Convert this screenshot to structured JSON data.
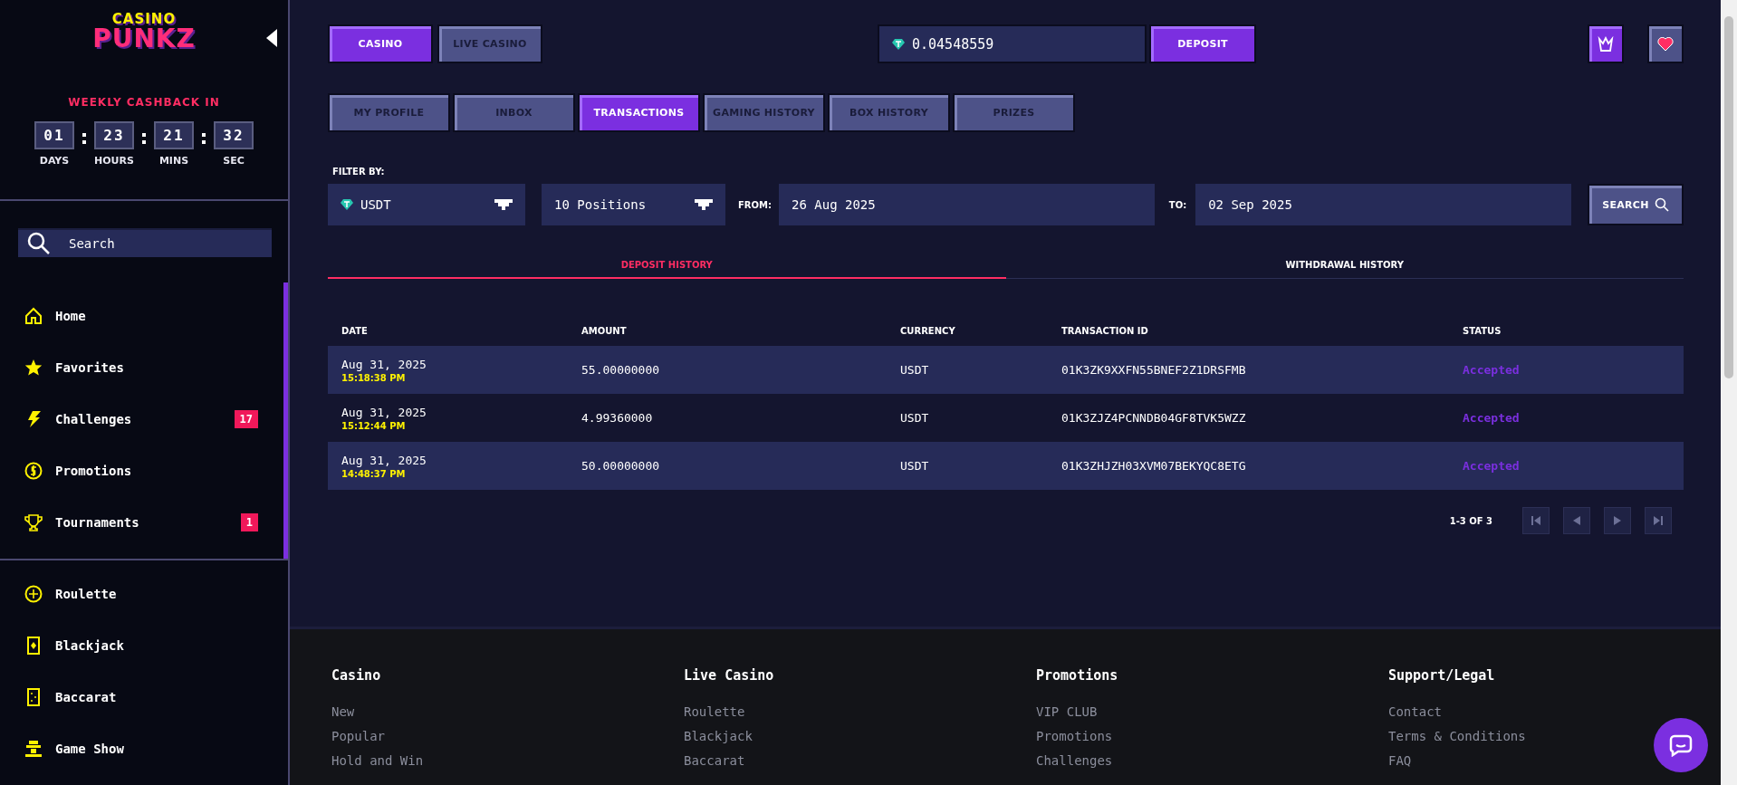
{
  "sidebar": {
    "logo": {
      "top": "CASINO",
      "bottom": "PUNKZ"
    },
    "cashback": {
      "title": "WEEKLY CASHBACK IN",
      "units": [
        {
          "value": "01",
          "label": "DAYS"
        },
        {
          "value": "23",
          "label": "HOURS"
        },
        {
          "value": "21",
          "label": "MINS"
        },
        {
          "value": "32",
          "label": "SEC"
        }
      ]
    },
    "search": {
      "placeholder": "Search"
    },
    "nav": [
      {
        "kind": "home",
        "label": "Home"
      },
      {
        "kind": "star",
        "label": "Favorites"
      },
      {
        "kind": "bolt",
        "label": "Challenges",
        "badge": "17"
      },
      {
        "kind": "coin",
        "label": "Promotions"
      },
      {
        "kind": "trophy",
        "label": "Tournaments",
        "badge": "1"
      }
    ],
    "games": [
      {
        "kind": "roulette",
        "label": "Roulette"
      },
      {
        "kind": "card",
        "label": "Blackjack"
      },
      {
        "kind": "domino",
        "label": "Baccarat"
      },
      {
        "kind": "host",
        "label": "Game Show"
      }
    ]
  },
  "topbar": {
    "modes": [
      {
        "label": "CASINO",
        "selected": true
      },
      {
        "label": "LIVE CASINO",
        "selected": false
      }
    ],
    "balance": "0.04548559",
    "deposit": "DEPOSIT"
  },
  "profile_tabs": [
    {
      "label": "MY PROFILE",
      "selected": false
    },
    {
      "label": "INBOX",
      "selected": false
    },
    {
      "label": "TRANSACTIONS",
      "selected": true
    },
    {
      "label": "GAMING HISTORY",
      "selected": false
    },
    {
      "label": "BOX HISTORY",
      "selected": false
    },
    {
      "label": "PRIZES",
      "selected": false
    }
  ],
  "filter": {
    "title": "FILTER BY:",
    "currency": "USDT",
    "positions": "10 Positions",
    "from_label": "FROM:",
    "from": "26 Aug 2025",
    "to_label": "TO:",
    "to": "02 Sep 2025",
    "search": "SEARCH"
  },
  "history_tabs": [
    {
      "label": "DEPOSIT HISTORY",
      "selected": true
    },
    {
      "label": "WITHDRAWAL HISTORY",
      "selected": false
    }
  ],
  "table": {
    "columns": [
      "DATE",
      "AMOUNT",
      "CURRENCY",
      "TRANSACTION ID",
      "STATUS"
    ],
    "rows": [
      {
        "date": "Aug 31, 2025",
        "time": "15:18:38 PM",
        "amount": "55.00000000",
        "currency": "USDT",
        "id": "01K3ZK9XXFN55BNEF2Z1DRSFMB",
        "status": "Accepted"
      },
      {
        "date": "Aug 31, 2025",
        "time": "15:12:44 PM",
        "amount": "4.99360000",
        "currency": "USDT",
        "id": "01K3ZJZ4PCNNDB04GF8TVK5WZZ",
        "status": "Accepted"
      },
      {
        "date": "Aug 31, 2025",
        "time": "14:48:37 PM",
        "amount": "50.00000000",
        "currency": "USDT",
        "id": "01K3ZHJZH03XVM07BEKYQC8ETG",
        "status": "Accepted"
      }
    ]
  },
  "pagination": {
    "range": "1-3 OF 3",
    "buttons": [
      {
        "kind": "first",
        "disabled": true
      },
      {
        "kind": "prev",
        "disabled": true
      },
      {
        "kind": "next",
        "disabled": true
      },
      {
        "kind": "last",
        "disabled": true
      }
    ]
  },
  "footer": [
    {
      "title": "Casino",
      "links": [
        "New",
        "Popular",
        "Hold and Win"
      ]
    },
    {
      "title": "Live Casino",
      "links": [
        "Roulette",
        "Blackjack",
        "Baccarat"
      ]
    },
    {
      "title": "Promotions",
      "links": [
        "VIP CLUB",
        "Promotions",
        "Challenges"
      ]
    },
    {
      "title": "Support/Legal",
      "links": [
        "Contact",
        "Terms & Conditions",
        "FAQ"
      ]
    }
  ]
}
